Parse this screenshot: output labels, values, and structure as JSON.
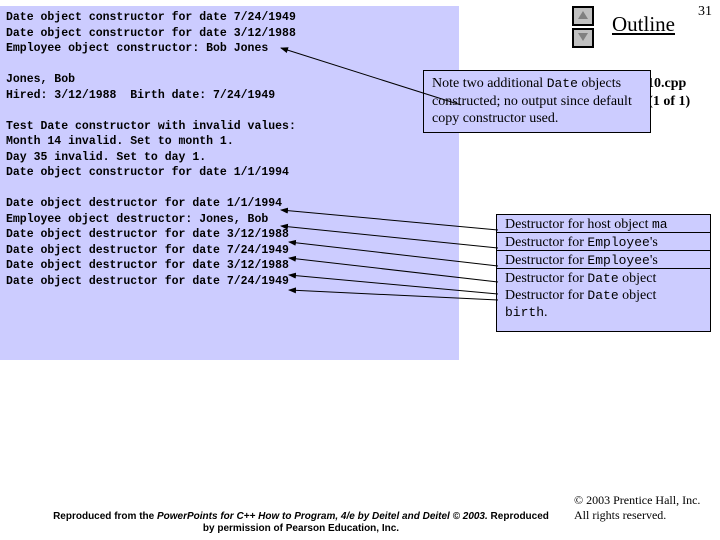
{
  "page_number": "31",
  "outline_label": "Outline",
  "file_info": {
    "name": "_10.cpp",
    "detail": "t (1 of 1)"
  },
  "console": "Date object constructor for date 7/24/1949\nDate object constructor for date 3/12/1988\nEmployee object constructor: Bob Jones\n\nJones, Bob\nHired: 3/12/1988  Birth date: 7/24/1949\n\nTest Date constructor with invalid values:\nMonth 14 invalid. Set to month 1.\nDay 35 invalid. Set to day 1.\nDate object constructor for date 1/1/1994\n\nDate object destructor for date 1/1/1994\nEmployee object destructor: Jones, Bob\nDate object destructor for date 3/12/1988\nDate object destructor for date 7/24/1949\nDate object destructor for date 3/12/1988\nDate object destructor for date 7/24/1949",
  "callout1": {
    "pre": "Note two additional ",
    "code": "Date",
    "post": " objects constructed; no output since default copy constructor used."
  },
  "stack": [
    {
      "pre": "Destructor for host object ",
      "code": "ma",
      "post": ""
    },
    {
      "pre": "Destructor for ",
      "code": "Employee",
      "post": "'s"
    },
    {
      "pre": "Destructor for ",
      "code": "Employee",
      "post": "'s"
    },
    {
      "pre": "Destructor for ",
      "code": "Date",
      "post": " object"
    },
    {
      "pre": "Destructor for ",
      "code": "Date",
      "post": " object "
    },
    {
      "code2": "birth",
      "post2": "."
    }
  ],
  "copyright": "© 2003 Prentice Hall, Inc.\nAll rights reserved.",
  "repro": {
    "l1": "Reproduced from the ",
    "ital": "PowerPoints for C++ How to Program, 4/e by Deitel and Deitel © 2003.",
    "l2": " Reproduced by permission of Pearson Education, Inc."
  }
}
